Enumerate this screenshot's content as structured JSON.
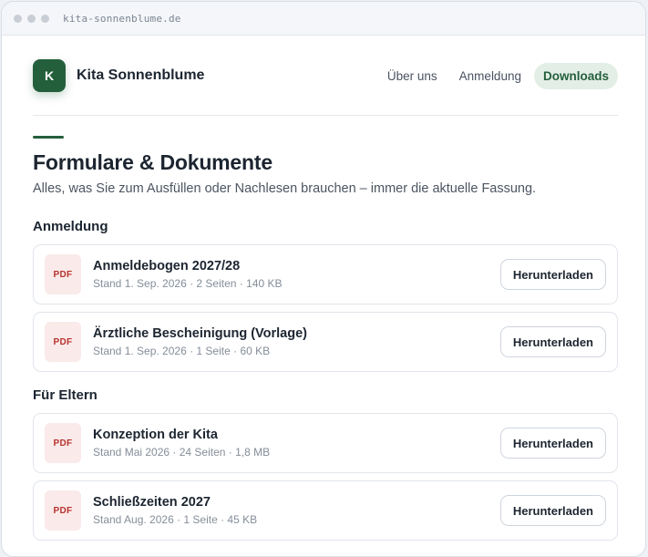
{
  "browser": {
    "url": "kita-sonnenblume.de"
  },
  "header": {
    "logo_letter": "K",
    "brand": "Kita Sonnenblume",
    "nav": [
      {
        "label": "Über uns",
        "active": false
      },
      {
        "label": "Anmeldung",
        "active": false
      },
      {
        "label": "Downloads",
        "active": true
      }
    ]
  },
  "page": {
    "title": "Formulare & Dokumente",
    "intro": "Alles, was Sie zum Ausfüllen oder Nachlesen brauchen – immer die aktuelle Fassung."
  },
  "sections": [
    {
      "title": "Anmeldung",
      "docs": [
        {
          "badge": "PDF",
          "title": "Anmeldebogen 2027/28",
          "meta": "Stand 1. Sep. 2026 · 2 Seiten · 140 KB",
          "button": "Herunterladen"
        },
        {
          "badge": "PDF",
          "title": "Ärztliche Bescheinigung (Vorlage)",
          "meta": "Stand 1. Sep. 2026 · 1 Seite · 60 KB",
          "button": "Herunterladen"
        }
      ]
    },
    {
      "title": "Für Eltern",
      "docs": [
        {
          "badge": "PDF",
          "title": "Konzeption der Kita",
          "meta": "Stand Mai 2026 · 24 Seiten · 1,8 MB",
          "button": "Herunterladen"
        },
        {
          "badge": "PDF",
          "title": "Schließzeiten 2027",
          "meta": "Stand Aug. 2026 · 1 Seite · 45 KB",
          "button": "Herunterladen"
        }
      ]
    }
  ],
  "colors": {
    "brand_green": "#245f3c",
    "pdf_red": "#b5332f",
    "nav_active_bg": "#e3eee6"
  }
}
